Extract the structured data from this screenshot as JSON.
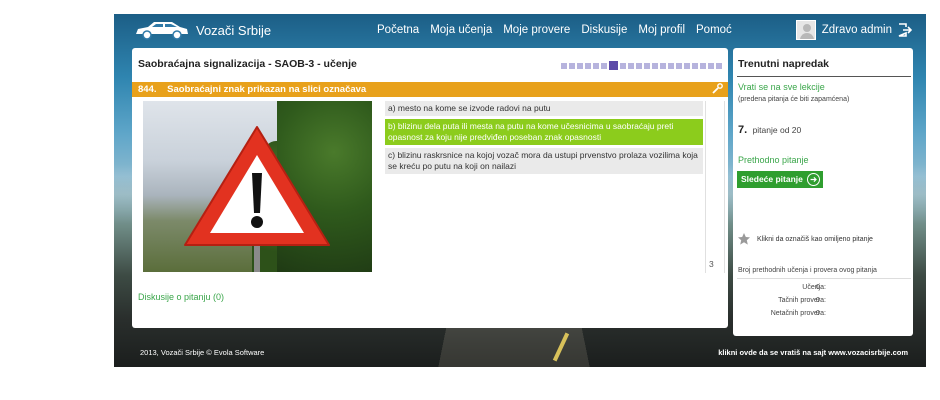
{
  "app": {
    "name": "Vozači Srbije"
  },
  "nav": {
    "items": [
      {
        "label": "Početna"
      },
      {
        "label": "Moja učenja"
      },
      {
        "label": "Moje provere"
      },
      {
        "label": "Diskusije"
      },
      {
        "label": "Moj profil"
      },
      {
        "label": "Pomoć"
      }
    ]
  },
  "user": {
    "greeting": "Zdravo admin"
  },
  "lesson": {
    "title": "Saobraćajna signalizacija - SAOB-3 - učenje",
    "progress_total": 20,
    "progress_current": 7
  },
  "question": {
    "number": "844.",
    "text": "Saobraćajni znak prikazan na slici označava",
    "answers": [
      {
        "text": "a) mesto na kome se izvode radovi na putu",
        "correct": false
      },
      {
        "text": "b) blizinu dela puta ili mesta na putu na kome učesnicima u saobraćaju preti opasnost za koju nije predviđen poseban znak opasnosti",
        "correct": true
      },
      {
        "text": "c) blizinu raskrsnice na kojoj vozač mora da ustupi prvenstvo prolaza vozilima koja se kreću po putu na koji on nailazi",
        "correct": false
      }
    ],
    "page_number": "3",
    "discussion_link": "Diskusije o pitanju (0)"
  },
  "sidebar": {
    "title": "Trenutni napredak",
    "back_link": "Vrati se na sve lekcije",
    "back_note": "(predena pitanja će biti zapamćena)",
    "current_q": "7.",
    "of_label": "pitanje od 20",
    "prev_link": "Prethodno pitanje",
    "next_button": "Sledeće pitanje",
    "fav_label": "Klikni da označiš kao omiljeno pitanje",
    "stats_label": "Broj prethodnih učenja i provera ovog pitanja",
    "stats": [
      {
        "label": "Učenja:",
        "value": "0"
      },
      {
        "label": "Tačnih provera:",
        "value": "0"
      },
      {
        "label": "Netačnih provera:",
        "value": "0"
      }
    ]
  },
  "footer": {
    "left": "2013, Vozači Srbije © Evola Software",
    "right": "klikni ovde da se vratiš na sajt  www.vozacisrbije.com"
  },
  "colors": {
    "accent_orange": "#e8a11b",
    "correct_green": "#8ccc1c",
    "link_green": "#3aa64a",
    "progress_purple": "#5c4aa8"
  },
  "icons": {
    "logo": "car-icon",
    "logout": "logout-icon",
    "tool": "wrench-icon",
    "next": "arrow-right-circle-icon",
    "fav": "star-icon",
    "sign": "warning-triangle-icon"
  }
}
